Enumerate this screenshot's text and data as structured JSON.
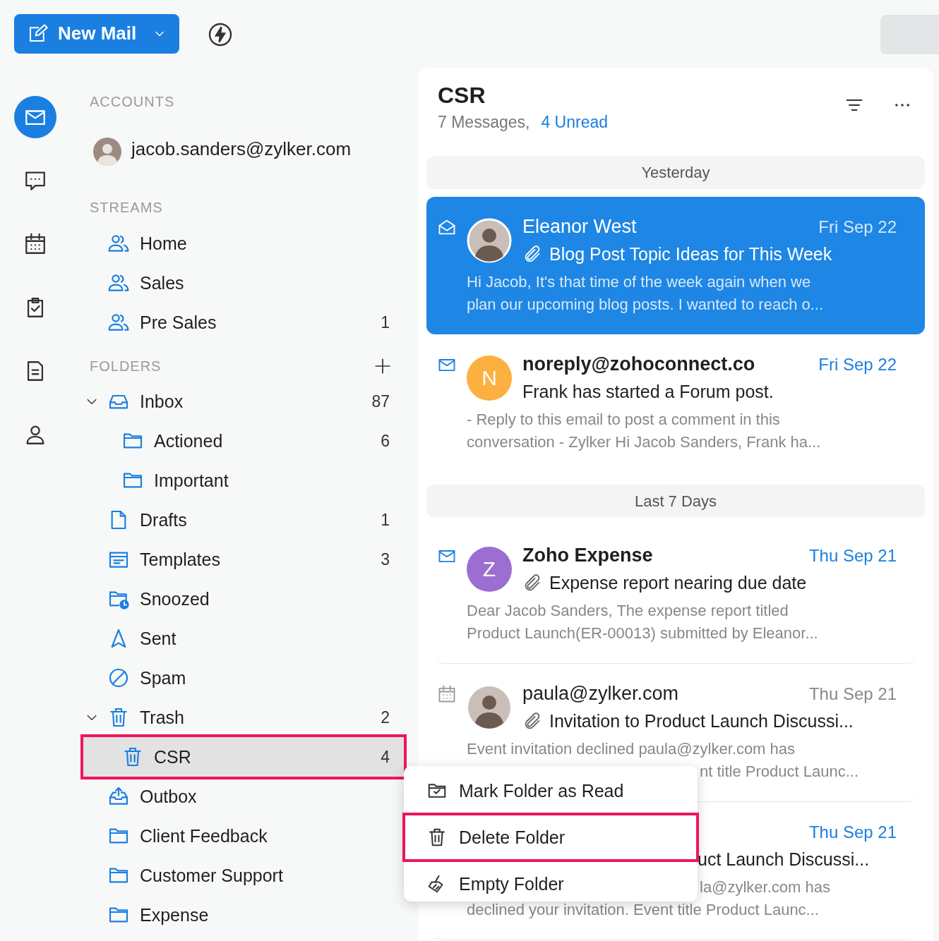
{
  "toolbar": {
    "new_mail": {
      "label": "New Mail"
    }
  },
  "nav_rail": [
    {
      "kind": "mail",
      "selected": true
    },
    {
      "kind": "chat",
      "selected": false
    },
    {
      "kind": "calendar",
      "selected": false
    },
    {
      "kind": "tasks",
      "selected": false
    },
    {
      "kind": "notes",
      "selected": false
    },
    {
      "kind": "contacts",
      "selected": false
    }
  ],
  "accounts": {
    "heading": "ACCOUNTS",
    "items": [
      {
        "email": "jacob.sanders@zylker.com",
        "avatar": {
          "kind": "photo"
        }
      }
    ]
  },
  "streams": {
    "heading": "STREAMS",
    "items": [
      {
        "label": "Home",
        "selected": false
      },
      {
        "label": "Sales",
        "selected": false
      },
      {
        "label": "Pre Sales",
        "count": "1",
        "selected": false
      }
    ]
  },
  "folders": {
    "heading": "FOLDERS",
    "items": [
      {
        "kind": "inbox",
        "label": "Inbox",
        "count": "87",
        "selected": false,
        "expanded": true,
        "highlighted": false,
        "children": [
          {
            "kind": "folder",
            "label": "Actioned",
            "count": "6",
            "selected": false,
            "highlighted": false
          },
          {
            "kind": "folder",
            "label": "Important",
            "selected": false,
            "highlighted": false
          }
        ]
      },
      {
        "kind": "drafts",
        "label": "Drafts",
        "count": "1",
        "selected": false,
        "highlighted": false
      },
      {
        "kind": "templates",
        "label": "Templates",
        "count": "3",
        "selected": false,
        "highlighted": false
      },
      {
        "kind": "snoozed",
        "label": "Snoozed",
        "selected": false,
        "highlighted": false
      },
      {
        "kind": "sent",
        "label": "Sent",
        "selected": false,
        "highlighted": false
      },
      {
        "kind": "spam",
        "label": "Spam",
        "selected": false,
        "highlighted": false
      },
      {
        "kind": "trash",
        "label": "Trash",
        "count": "2",
        "selected": false,
        "expanded": true,
        "highlighted": false,
        "children": [
          {
            "kind": "trash",
            "label": "CSR",
            "count": "4",
            "selected": true,
            "highlighted": true
          }
        ]
      },
      {
        "kind": "outbox",
        "label": "Outbox",
        "selected": false,
        "highlighted": false
      },
      {
        "kind": "folder",
        "label": "Client Feedback",
        "selected": false,
        "highlighted": false
      },
      {
        "kind": "folder",
        "label": "Customer Support",
        "selected": false,
        "highlighted": false
      },
      {
        "kind": "folder",
        "label": "Expense",
        "selected": false,
        "highlighted": false
      }
    ]
  },
  "message_list": {
    "title": "CSR",
    "message_count": "7 Messages,",
    "unread_count": "4 Unread",
    "groups": [
      {
        "label": "Yesterday",
        "emails": [
          {
            "kind": "envelope-open",
            "avatar": {
              "kind": "photo"
            },
            "sender": "Eleanor West",
            "date": "Fri Sep 22",
            "unread": false,
            "selected": true,
            "attachment": true,
            "subject": "Blog Post Topic Ideas for This Week",
            "preview": [
              {
                "text": "Hi Jacob, It's that time of the week again when we",
                "covered": false
              },
              {
                "text": "plan our upcoming blog posts. I wanted to reach o...",
                "covered": false
              }
            ]
          },
          {
            "kind": "envelope",
            "avatar": {
              "kind": "letter",
              "letter": "N",
              "color": "#fbb040"
            },
            "sender": "noreply@zohoconnect.co",
            "date": "Fri Sep 22",
            "unread": true,
            "selected": false,
            "attachment": false,
            "subject": "Frank has started a Forum post.",
            "preview": [
              {
                "text": "- Reply to this email to post a comment in this",
                "covered": false
              },
              {
                "text": "conversation - Zylker Hi Jacob Sanders, Frank ha...",
                "covered": false
              }
            ]
          }
        ]
      },
      {
        "label": "Last 7 Days",
        "emails": [
          {
            "kind": "envelope",
            "avatar": {
              "kind": "letter",
              "letter": "Z",
              "color": "#9b6fd2"
            },
            "sender": "Zoho Expense",
            "date": "Thu Sep 21",
            "unread": true,
            "selected": false,
            "attachment": true,
            "subject": "Expense report nearing due date",
            "preview": [
              {
                "text": "Dear Jacob Sanders, The expense report titled",
                "covered": false
              },
              {
                "text": "Product Launch(ER-00013) submitted by Eleanor...",
                "covered": false
              }
            ]
          },
          {
            "kind": "calendar",
            "avatar": {
              "kind": "photo"
            },
            "sender": "paula@zylker.com",
            "date": "Thu Sep 21",
            "unread": false,
            "selected": false,
            "attachment": true,
            "subject": "Invitation to Product Launch Discussi...",
            "preview": [
              {
                "text": "Event invitation declined paula@zylker.com has",
                "covered": false
              },
              {
                "text": "nt title Product Launc...",
                "covered": true
              }
            ]
          },
          {
            "date": "Thu Sep 21",
            "unread": true,
            "selected": false,
            "subject": "uct Launch Discussi...",
            "subject_covered": true,
            "preview": [
              {
                "text": "la@zylker.com has",
                "covered": true
              },
              {
                "text": "declined your invitation. Event title Product Launc...",
                "covered": false
              }
            ]
          }
        ]
      }
    ]
  },
  "context_menu": [
    {
      "kind": "folder-check",
      "label": "Mark Folder as Read",
      "highlighted": false
    },
    {
      "kind": "trash",
      "label": "Delete Folder",
      "highlighted": true
    },
    {
      "kind": "broom",
      "label": "Empty Folder",
      "highlighted": false
    }
  ]
}
